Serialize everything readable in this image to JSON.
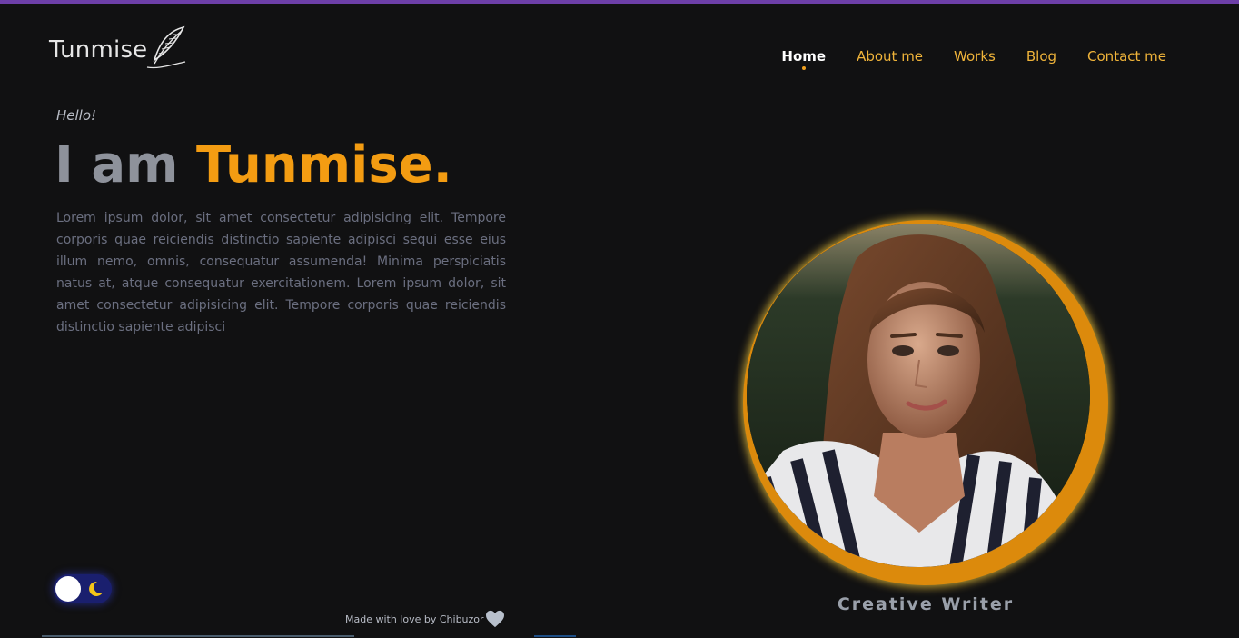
{
  "brand": {
    "name": "Tunmise",
    "logo_icon": "feather-icon",
    "accent_color": "#f39c12",
    "top_bar_color": "#6d3fa8"
  },
  "nav": {
    "items": [
      {
        "label": "Home",
        "active": true
      },
      {
        "label": "About me",
        "active": false
      },
      {
        "label": "Works",
        "active": false
      },
      {
        "label": "Blog",
        "active": false
      },
      {
        "label": "Contact me",
        "active": false
      }
    ]
  },
  "hero": {
    "greeting": "Hello!",
    "headline_lead": "I am",
    "headline_name": "Tunmise.",
    "intro": "Lorem ipsum dolor, sit amet consectetur adipisicing elit. Tempore corporis quae reiciendis distinctio sapiente adipisci sequi esse eius illum nemo, omnis, consequatur assumenda! Minima perspiciatis natus at, atque consequatur exercitationem. Lorem ipsum dolor, sit amet consectetur adipisicing elit. Tempore corporis quae reiciendis distinctio sapiente adipisci"
  },
  "profile": {
    "role": "Creative Writer",
    "ring_color": "#dc8a0c"
  },
  "theme_toggle": {
    "icon": "moon-icon",
    "mode": "dark"
  },
  "footer": {
    "credit": "Made with love by Chibuzor",
    "icon": "heart-icon"
  }
}
